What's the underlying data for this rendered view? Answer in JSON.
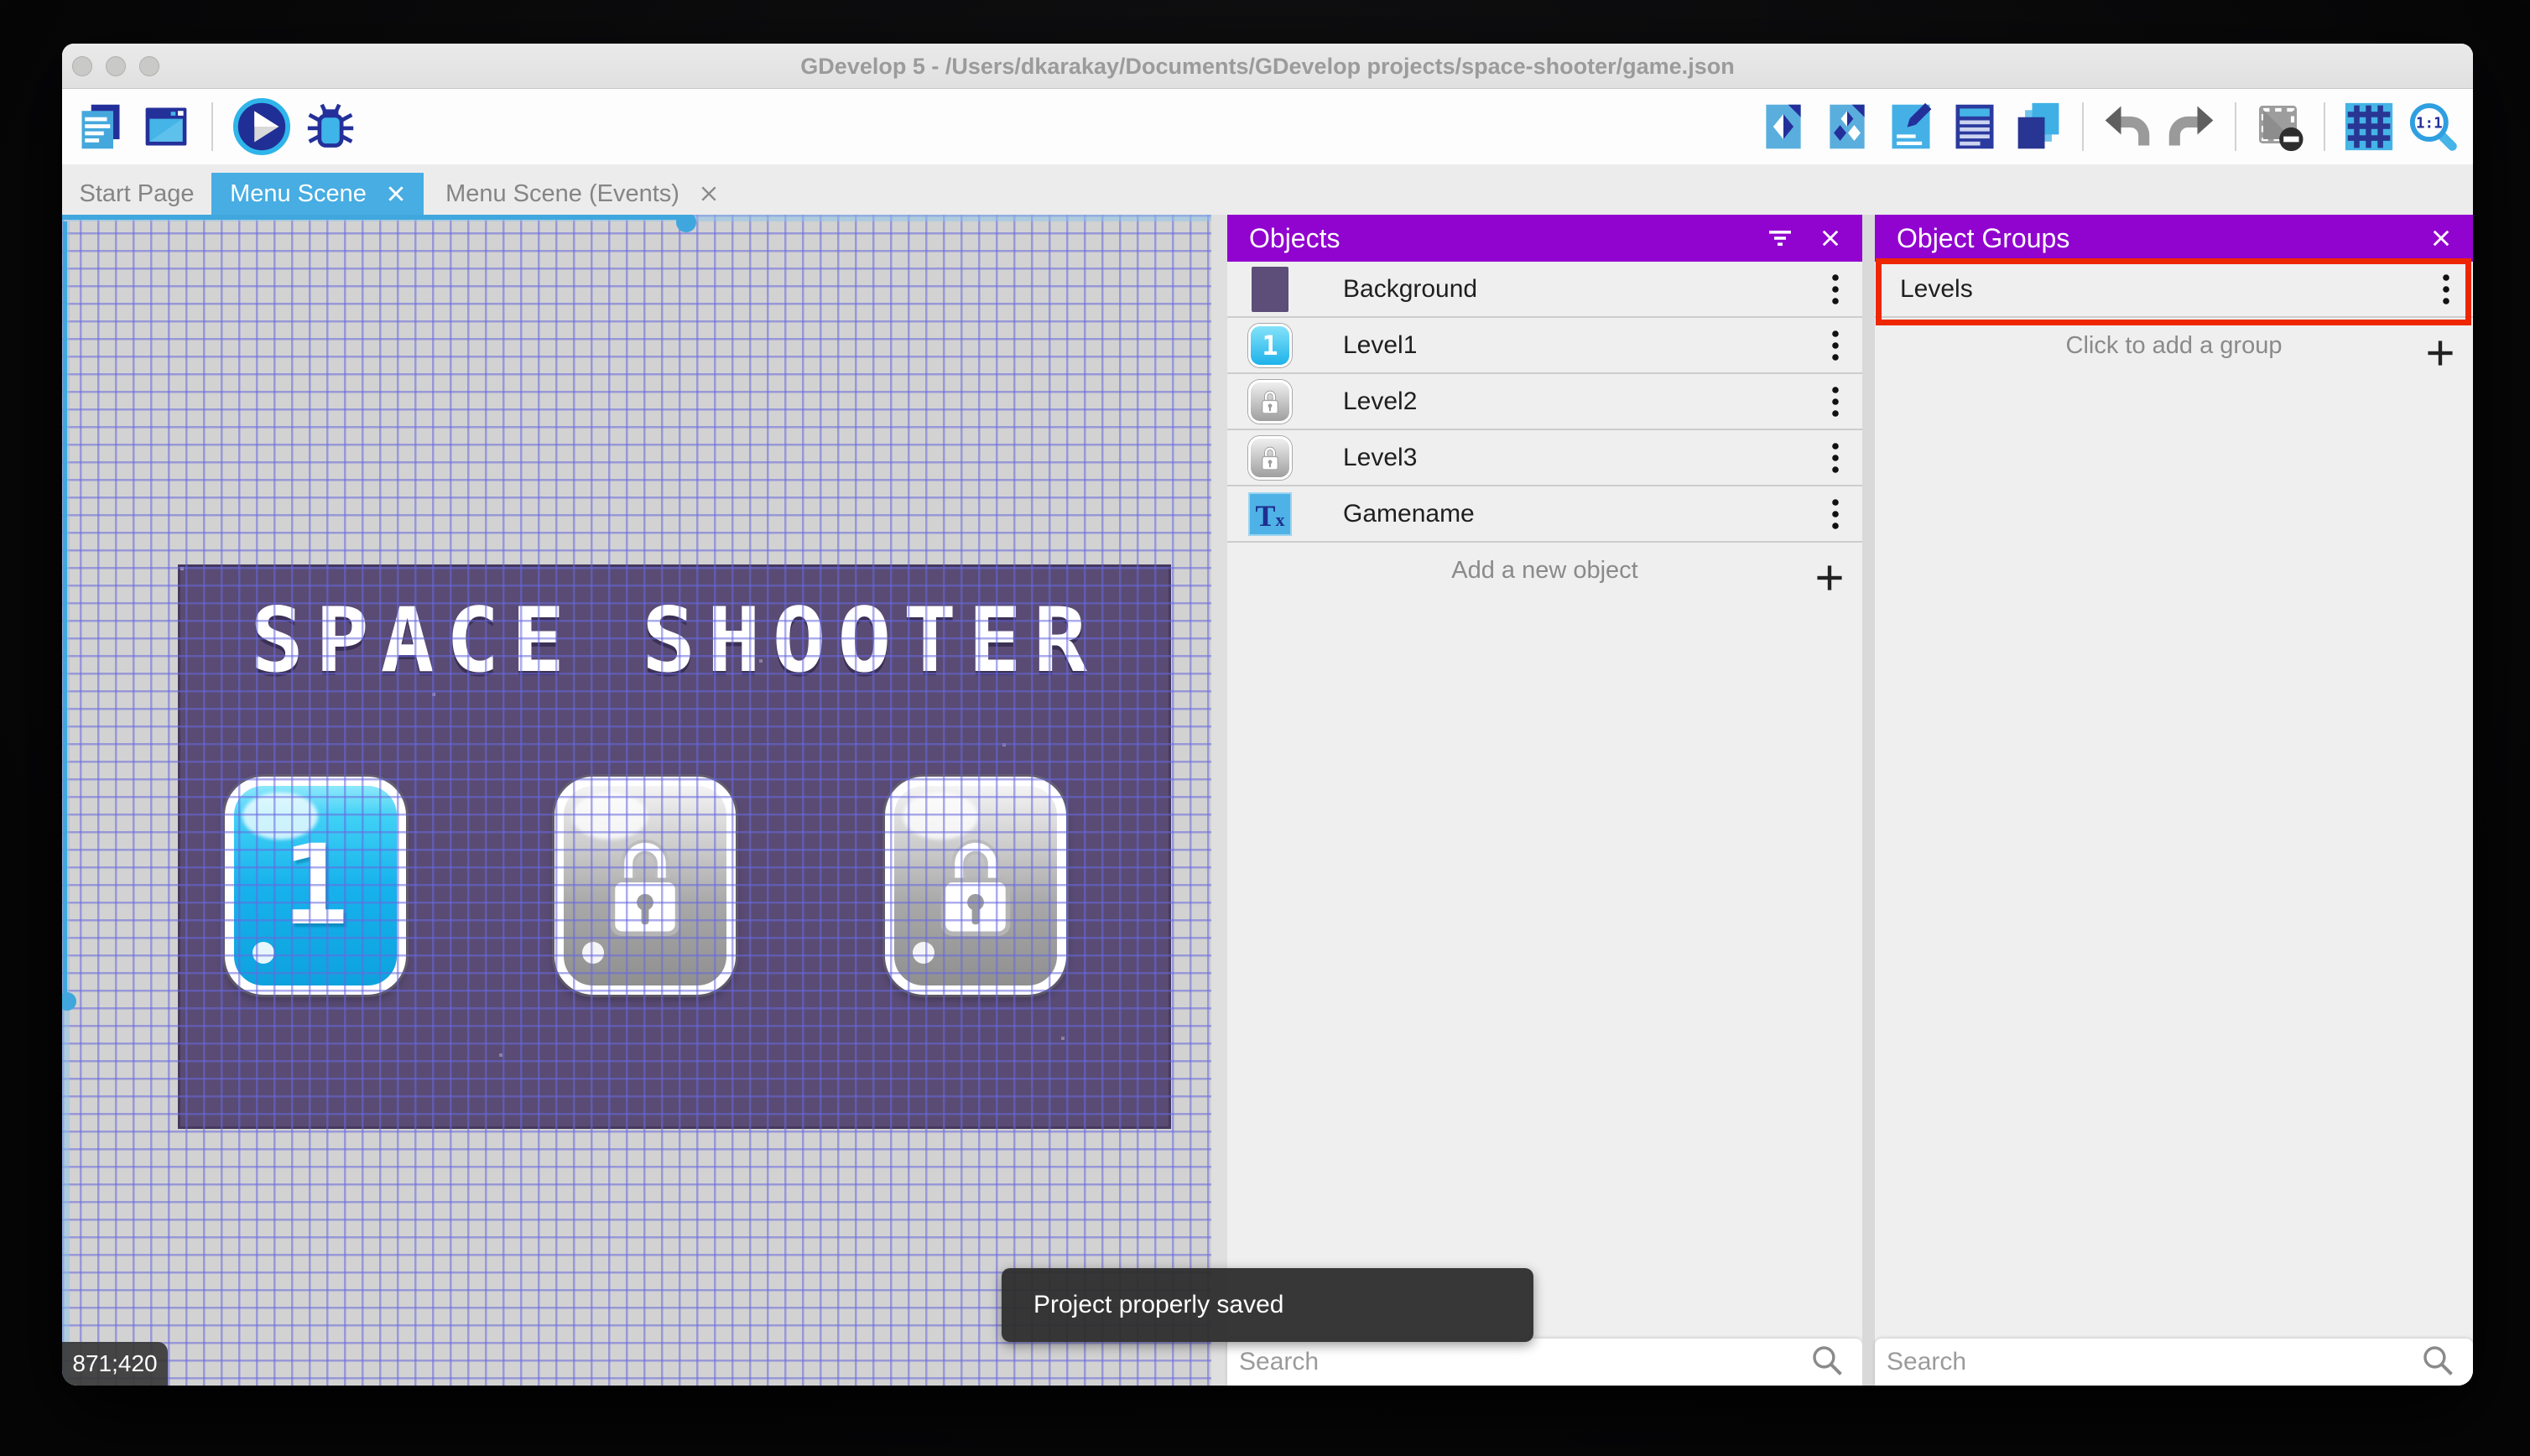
{
  "colors": {
    "accent_blue": "#47ade2",
    "panel_purple": "#9103cf",
    "highlight_red": "#ee2600",
    "banner_purple": "#594b74",
    "canvas_gray": "#d2d2d2",
    "button_blue": "#17b2ec",
    "toast_bg": "#2f2f2f",
    "icon_navy": "#24309a",
    "icon_blue": "#45b0e6"
  },
  "window": {
    "title": "GDevelop 5 - /Users/dkarakay/Documents/GDevelop projects/space-shooter/game.json"
  },
  "toolbar": {
    "left_icons": [
      {
        "name": "project-manager"
      },
      {
        "name": "scene-editor-window"
      },
      {
        "name": "play-preview"
      },
      {
        "name": "debug"
      }
    ],
    "right_icons": [
      {
        "name": "objects-editor"
      },
      {
        "name": "object-groups-editor"
      },
      {
        "name": "properties"
      },
      {
        "name": "instances-list"
      },
      {
        "name": "layers-editor"
      },
      {
        "name": "undo"
      },
      {
        "name": "redo"
      },
      {
        "name": "window-mask"
      },
      {
        "name": "grid"
      },
      {
        "name": "zoom-1-1"
      }
    ],
    "zoom_icon_label": "1:1"
  },
  "tabs": {
    "items": [
      {
        "label": "Start Page",
        "active": false,
        "closable": false
      },
      {
        "label": "Menu Scene",
        "active": true,
        "closable": true
      },
      {
        "label": "Menu Scene (Events)",
        "active": false,
        "closable": true
      }
    ]
  },
  "scene": {
    "banner_title": "SPACE SHOOTER",
    "level_button_label": "1",
    "locked_levels": 2,
    "coordinates": "871;420"
  },
  "objects_panel": {
    "title": "Objects",
    "items": [
      {
        "name": "Background",
        "thumb": "purple-swatch"
      },
      {
        "name": "Level1",
        "thumb": "blue-level-button",
        "thumb_glyph": "1"
      },
      {
        "name": "Level2",
        "thumb": "locked-level-button"
      },
      {
        "name": "Level3",
        "thumb": "locked-level-button"
      },
      {
        "name": "Gamename",
        "thumb": "text-object",
        "thumb_glyph": "T"
      }
    ],
    "add_label": "Add a new object",
    "search_placeholder": "Search"
  },
  "groups_panel": {
    "title": "Object Groups",
    "items": [
      {
        "name": "Levels",
        "highlighted": true
      }
    ],
    "add_label": "Click to add a group",
    "search_placeholder": "Search"
  },
  "toast": {
    "message": "Project properly saved"
  }
}
